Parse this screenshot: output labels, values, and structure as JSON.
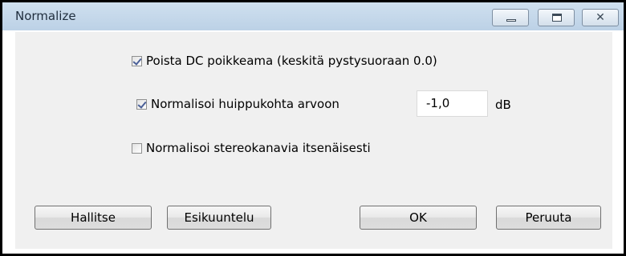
{
  "window": {
    "title": "Normalize"
  },
  "title_buttons": {
    "minimize_icon": "minimize-icon",
    "maximize_icon": "maximize-icon",
    "close_glyph": "✕"
  },
  "options": {
    "remove_dc": {
      "label": "Poista DC poikkeama (keskitä pystysuoraan 0.0)",
      "checked": true
    },
    "normalize_peak": {
      "label": "Normalisoi huippukohta arvoon",
      "checked": true,
      "value": "-1,0",
      "unit": "dB"
    },
    "stereo_independent": {
      "label": "Normalisoi stereokanavia itsenäisesti",
      "checked": false
    }
  },
  "buttons": {
    "manage": "Hallitse",
    "preview": "Esikuuntelu",
    "ok": "OK",
    "cancel": "Peruuta"
  }
}
